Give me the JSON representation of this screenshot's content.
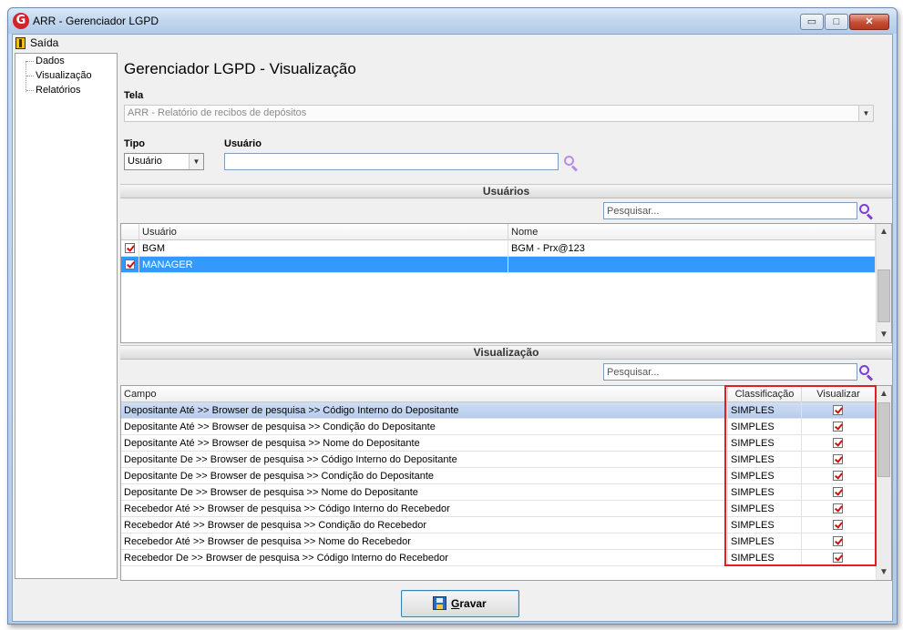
{
  "window": {
    "title": "ARR - Gerenciador LGPD",
    "logo_letter": "G",
    "buttons": {
      "minimize": "▭",
      "maximize": "□",
      "close": "✕"
    }
  },
  "menu": {
    "exit_label": "Saída"
  },
  "tree": {
    "items": [
      "Dados",
      "Visualização",
      "Relatórios"
    ]
  },
  "page": {
    "title": "Gerenciador LGPD - Visualização"
  },
  "screen": {
    "label": "Tela",
    "value": "ARR - Relatório de recibos de depósitos"
  },
  "type": {
    "label": "Tipo",
    "value": "Usuário"
  },
  "user": {
    "label": "Usuário",
    "value": ""
  },
  "users_section": {
    "title": "Usuários",
    "search_placeholder": "Pesquisar...",
    "columns": [
      "Usuário",
      "Nome"
    ],
    "rows": [
      {
        "checked": true,
        "user": "BGM",
        "name": "BGM - Prx@123",
        "selected": false
      },
      {
        "checked": true,
        "user": "MANAGER",
        "name": "",
        "selected": true
      }
    ]
  },
  "view_section": {
    "title": "Visualização",
    "search_placeholder": "Pesquisar...",
    "columns": [
      "Campo",
      "Classificação",
      "Visualizar"
    ],
    "rows": [
      {
        "field": "Depositante Até >> Browser de pesquisa >> Código Interno do Depositante",
        "class": "SIMPLES",
        "view": true,
        "selected": true
      },
      {
        "field": "Depositante Até >> Browser de pesquisa >> Condição do Depositante",
        "class": "SIMPLES",
        "view": true,
        "selected": false
      },
      {
        "field": "Depositante Até >> Browser de pesquisa >> Nome do Depositante",
        "class": "SIMPLES",
        "view": true,
        "selected": false
      },
      {
        "field": "Depositante De >> Browser de pesquisa >> Código Interno do Depositante",
        "class": "SIMPLES",
        "view": true,
        "selected": false
      },
      {
        "field": "Depositante De >> Browser de pesquisa >> Condição do Depositante",
        "class": "SIMPLES",
        "view": true,
        "selected": false
      },
      {
        "field": "Depositante De >> Browser de pesquisa >> Nome do Depositante",
        "class": "SIMPLES",
        "view": true,
        "selected": false
      },
      {
        "field": "Recebedor Até >> Browser de pesquisa >> Código Interno do Recebedor",
        "class": "SIMPLES",
        "view": true,
        "selected": false
      },
      {
        "field": "Recebedor Até >> Browser de pesquisa >> Condição do Recebedor",
        "class": "SIMPLES",
        "view": true,
        "selected": false
      },
      {
        "field": "Recebedor Até >> Browser de pesquisa >> Nome do Recebedor",
        "class": "SIMPLES",
        "view": true,
        "selected": false
      },
      {
        "field": "Recebedor De >> Browser de pesquisa >> Código Interno do Recebedor",
        "class": "SIMPLES",
        "view": true,
        "selected": false
      }
    ]
  },
  "save_button": {
    "label": "Gravar"
  },
  "colors": {
    "selection": "#3399ff",
    "selection_light": "#b7cdee",
    "highlight_box": "#e02020"
  }
}
